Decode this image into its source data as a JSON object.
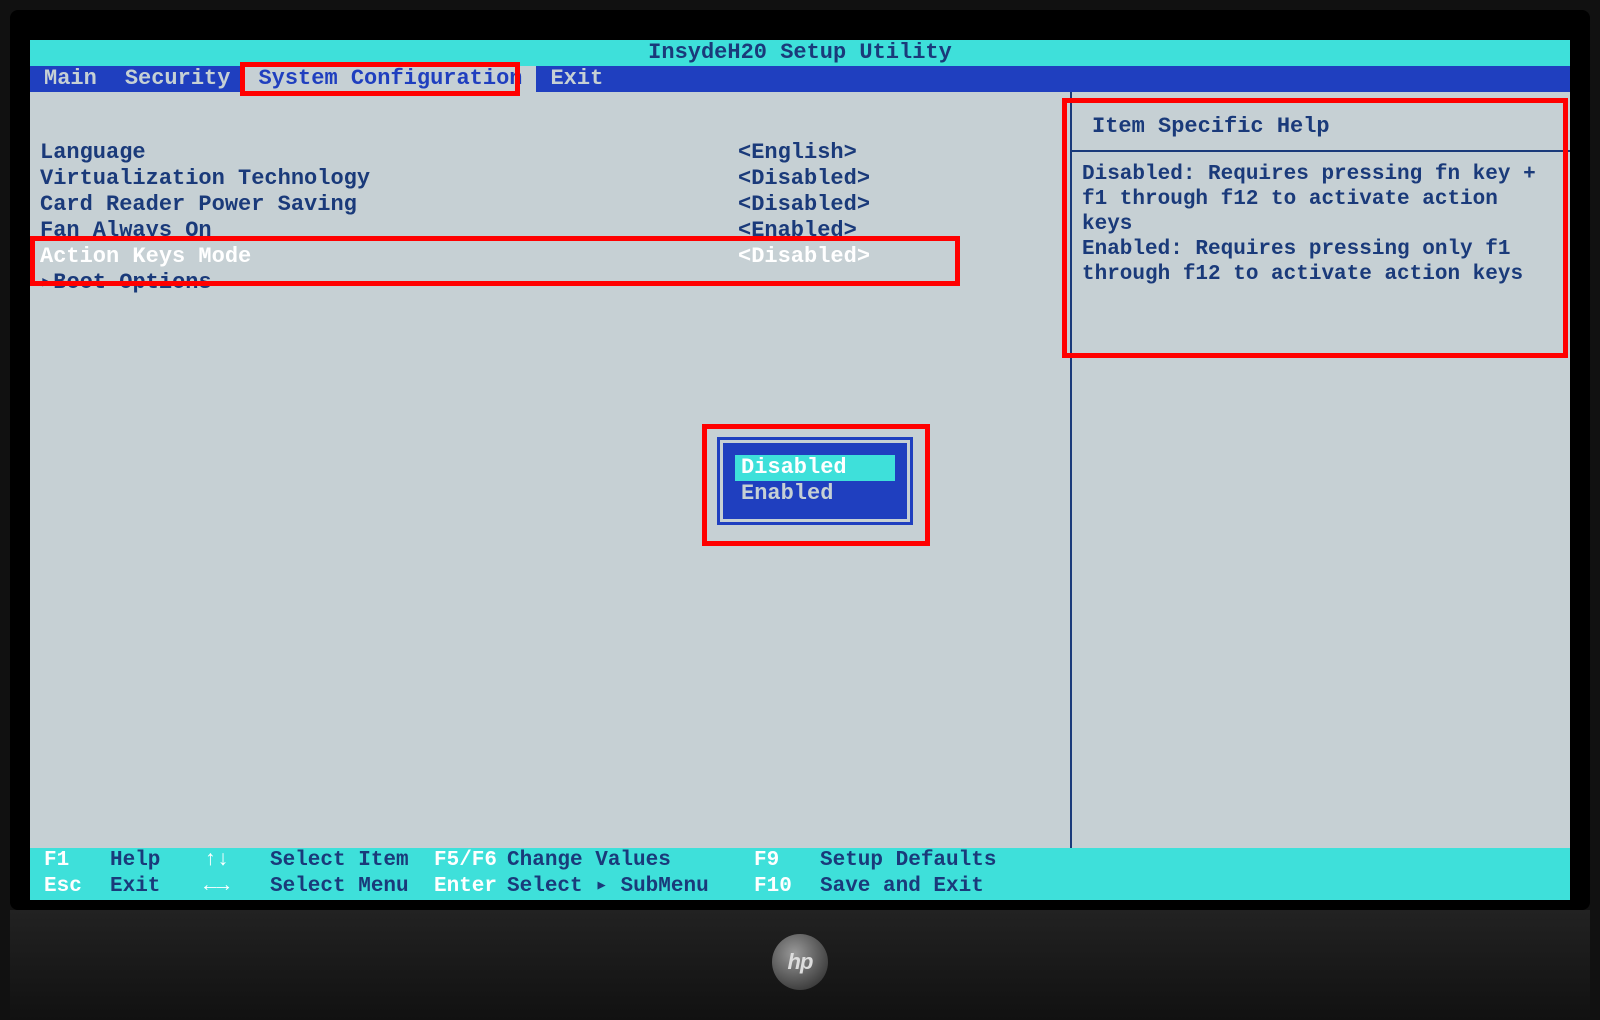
{
  "title": "InsydeH20 Setup Utility",
  "tabs": {
    "main": "Main",
    "security": "Security",
    "syscfg": "System Configuration",
    "exit": "Exit"
  },
  "settings": [
    {
      "label": "Language",
      "value": "<English>"
    },
    {
      "label": "Virtualization Technology",
      "value": "<Disabled>"
    },
    {
      "label": "Card Reader Power Saving",
      "value": "<Disabled>"
    },
    {
      "label": "Fan Always On",
      "value": "<Enabled>"
    },
    {
      "label": "Action Keys Mode",
      "value": "<Disabled>"
    },
    {
      "label": "▸Boot Options",
      "value": ""
    }
  ],
  "help": {
    "title": "Item Specific Help",
    "body": "Disabled: Requires pressing fn key + f1 through f12 to activate action keys\nEnabled: Requires pressing only f1 through f12 to activate action keys"
  },
  "popup": {
    "options": [
      "Disabled",
      "Enabled"
    ],
    "selected": "Disabled"
  },
  "footer": {
    "r1": [
      {
        "k": "F1",
        "d": "Help"
      },
      {
        "k": "↑↓",
        "d": "Select Item"
      },
      {
        "k": "F5/F6",
        "d": "Change Values"
      },
      {
        "k": "F9",
        "d": "Setup Defaults"
      }
    ],
    "r2": [
      {
        "k": "Esc",
        "d": "Exit"
      },
      {
        "k": "←→",
        "d": "Select Menu"
      },
      {
        "k": "Enter",
        "d": "Select ▸ SubMenu"
      },
      {
        "k": "F10",
        "d": "Save and Exit"
      }
    ]
  },
  "logo": "hp"
}
